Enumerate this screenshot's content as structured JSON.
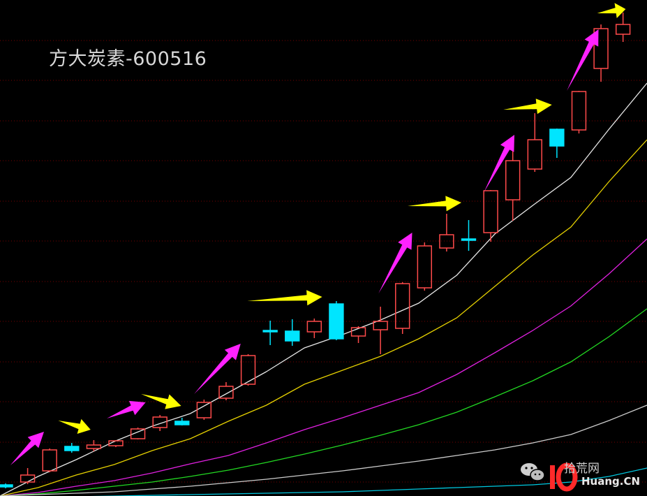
{
  "title": "方大炭素-600516",
  "watermark": {
    "site": "拾荒网",
    "domain": "Huang.CN"
  },
  "colors": {
    "background": "#000000",
    "grid": "#7a0000",
    "up_candle": "#ff4a4a",
    "down_candle": "#00e5ff",
    "ma_white": "#e6e6e6",
    "ma_yellow": "#e5d000",
    "ma_magenta": "#e020e0",
    "ma_green": "#22d822",
    "ma_gray": "#cccccc",
    "ma_cyan": "#00c8e0",
    "arrow_magenta": "#ff22ff",
    "arrow_yellow": "#ffff00"
  },
  "chart_data": {
    "type": "candlestick",
    "ylim": [
      0,
      710
    ],
    "grid": true,
    "candles": [
      {
        "dir": "down",
        "o": 16,
        "c": 13,
        "h": 18,
        "l": 11
      },
      {
        "dir": "up",
        "o": 20,
        "c": 30,
        "h": 40,
        "l": 17
      },
      {
        "dir": "up",
        "o": 36,
        "c": 66,
        "h": 68,
        "l": 34
      },
      {
        "dir": "down",
        "o": 71,
        "c": 65,
        "h": 76,
        "l": 62
      },
      {
        "dir": "up",
        "o": 68,
        "c": 73,
        "h": 80,
        "l": 64
      },
      {
        "dir": "up",
        "o": 72,
        "c": 79,
        "h": 80,
        "l": 70
      },
      {
        "dir": "up",
        "o": 82,
        "c": 96,
        "h": 98,
        "l": 81
      },
      {
        "dir": "up",
        "o": 98,
        "c": 113,
        "h": 116,
        "l": 93
      },
      {
        "dir": "down",
        "o": 107,
        "c": 102,
        "h": 112,
        "l": 101
      },
      {
        "dir": "up",
        "o": 112,
        "c": 134,
        "h": 138,
        "l": 109
      },
      {
        "dir": "up",
        "o": 140,
        "c": 157,
        "h": 163,
        "l": 137
      },
      {
        "dir": "up",
        "o": 160,
        "c": 201,
        "h": 203,
        "l": 158
      },
      {
        "dir": "down",
        "o": 237,
        "c": 236,
        "h": 251,
        "l": 216
      },
      {
        "dir": "down",
        "o": 236,
        "c": 222,
        "h": 253,
        "l": 215
      },
      {
        "dir": "up",
        "o": 235,
        "c": 250,
        "h": 254,
        "l": 226
      },
      {
        "dir": "down",
        "o": 275,
        "c": 225,
        "h": 279,
        "l": 223
      },
      {
        "dir": "up",
        "o": 229,
        "c": 241,
        "h": 243,
        "l": 219
      },
      {
        "dir": "up",
        "o": 238,
        "c": 250,
        "h": 271,
        "l": 203
      },
      {
        "dir": "up",
        "o": 240,
        "c": 304,
        "h": 306,
        "l": 232
      },
      {
        "dir": "up",
        "o": 298,
        "c": 358,
        "h": 363,
        "l": 294
      },
      {
        "dir": "up",
        "o": 355,
        "c": 374,
        "h": 404,
        "l": 350
      },
      {
        "dir": "down",
        "o": 368,
        "c": 367,
        "h": 395,
        "l": 351
      },
      {
        "dir": "up",
        "o": 377,
        "c": 437,
        "h": 438,
        "l": 364
      },
      {
        "dir": "up",
        "o": 424,
        "c": 480,
        "h": 498,
        "l": 394
      },
      {
        "dir": "up",
        "o": 468,
        "c": 510,
        "h": 548,
        "l": 464
      },
      {
        "dir": "down",
        "o": 525,
        "c": 501,
        "h": 526,
        "l": 484
      },
      {
        "dir": "up",
        "o": 524,
        "c": 579,
        "h": 580,
        "l": 519
      },
      {
        "dir": "up",
        "o": 612,
        "c": 669,
        "h": 675,
        "l": 593
      },
      {
        "dir": "up",
        "o": 661,
        "c": 675,
        "h": 692,
        "l": 650
      }
    ],
    "moving_averages": [
      {
        "color_key": "ma_white",
        "y": [
          0,
          28,
          52,
          78,
          100,
          118,
          148,
          178,
          212,
          231,
          252,
          276,
          316,
          375,
          416,
          456,
          525,
          591
        ]
      },
      {
        "color_key": "ma_yellow",
        "y": [
          0,
          12,
          30,
          45,
          65,
          82,
          107,
          130,
          160,
          180,
          200,
          225,
          255,
          300,
          345,
          385,
          450,
          510
        ]
      },
      {
        "color_key": "ma_magenta",
        "y": [
          0,
          5,
          14,
          22,
          33,
          46,
          58,
          76,
          95,
          112,
          130,
          148,
          174,
          205,
          237,
          272,
          318,
          368
        ]
      },
      {
        "color_key": "ma_green",
        "y": [
          0,
          3,
          8,
          14,
          20,
          28,
          37,
          48,
          60,
          73,
          87,
          102,
          120,
          142,
          165,
          192,
          228,
          268
        ]
      },
      {
        "color_key": "ma_gray",
        "y": [
          0,
          2,
          4,
          6,
          10,
          14,
          19,
          24,
          30,
          36,
          43,
          50,
          58,
          66,
          76,
          88,
          108,
          130
        ]
      },
      {
        "color_key": "ma_cyan",
        "y": [
          -2,
          -2,
          -1,
          0,
          1,
          2,
          3,
          4,
          5,
          6,
          8,
          10,
          12,
          14,
          16,
          20,
          28,
          40
        ]
      }
    ],
    "arrows": [
      {
        "color_key": "arrow_magenta",
        "from": [
          0.016,
          44
        ],
        "to": [
          0.068,
          92
        ]
      },
      {
        "color_key": "arrow_yellow",
        "from": [
          0.09,
          108
        ],
        "to": [
          0.14,
          95
        ]
      },
      {
        "color_key": "arrow_magenta",
        "from": [
          0.165,
          111
        ],
        "to": [
          0.225,
          134
        ]
      },
      {
        "color_key": "arrow_yellow",
        "from": [
          0.218,
          146
        ],
        "to": [
          0.28,
          129
        ]
      },
      {
        "color_key": "arrow_magenta",
        "from": [
          0.3,
          146
        ],
        "to": [
          0.372,
          218
        ]
      },
      {
        "color_key": "arrow_yellow",
        "from": [
          0.382,
          279
        ],
        "to": [
          0.498,
          285
        ]
      },
      {
        "color_key": "arrow_magenta",
        "from": [
          0.585,
          290
        ],
        "to": [
          0.637,
          377
        ]
      },
      {
        "color_key": "arrow_yellow",
        "from": [
          0.63,
          415
        ],
        "to": [
          0.713,
          420
        ]
      },
      {
        "color_key": "arrow_magenta",
        "from": [
          0.748,
          435
        ],
        "to": [
          0.795,
          517
        ]
      },
      {
        "color_key": "arrow_yellow",
        "from": [
          0.778,
          553
        ],
        "to": [
          0.853,
          560
        ]
      },
      {
        "color_key": "arrow_magenta",
        "from": [
          0.876,
          580
        ],
        "to": [
          0.925,
          668
        ]
      },
      {
        "color_key": "arrow_yellow",
        "from": [
          0.923,
          691
        ],
        "to": [
          0.967,
          697
        ]
      }
    ]
  }
}
